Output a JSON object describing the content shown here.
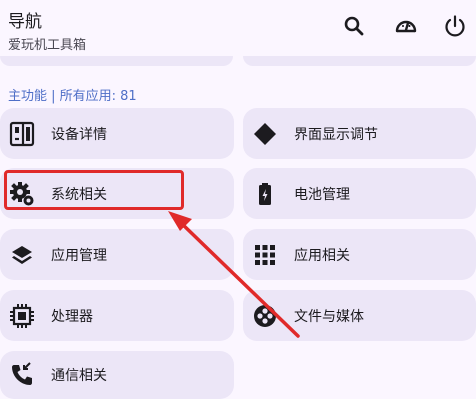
{
  "header": {
    "title": "导航",
    "subtitle": "爱玩机工具箱",
    "icons": [
      "search-icon",
      "speedometer-icon",
      "power-icon"
    ]
  },
  "section": {
    "label": "主功能 | 所有应用: 81"
  },
  "cards": [
    {
      "label": "设备详情",
      "icon": "device-details-icon"
    },
    {
      "label": "界面显示调节",
      "icon": "display-adjust-icon"
    },
    {
      "label": "系统相关",
      "icon": "system-gear-icon"
    },
    {
      "label": "电池管理",
      "icon": "battery-icon"
    },
    {
      "label": "应用管理",
      "icon": "app-manage-layers-icon"
    },
    {
      "label": "应用相关",
      "icon": "app-grid-icon"
    },
    {
      "label": "处理器",
      "icon": "processor-chip-icon"
    },
    {
      "label": "文件与媒体",
      "icon": "file-media-icon"
    },
    {
      "label": "通信相关",
      "icon": "phone-icon"
    }
  ],
  "colors": {
    "background": "#fbf6ff",
    "card": "#ece6f7",
    "accent": "#4f6fc7",
    "highlight": "#e02a2a"
  }
}
